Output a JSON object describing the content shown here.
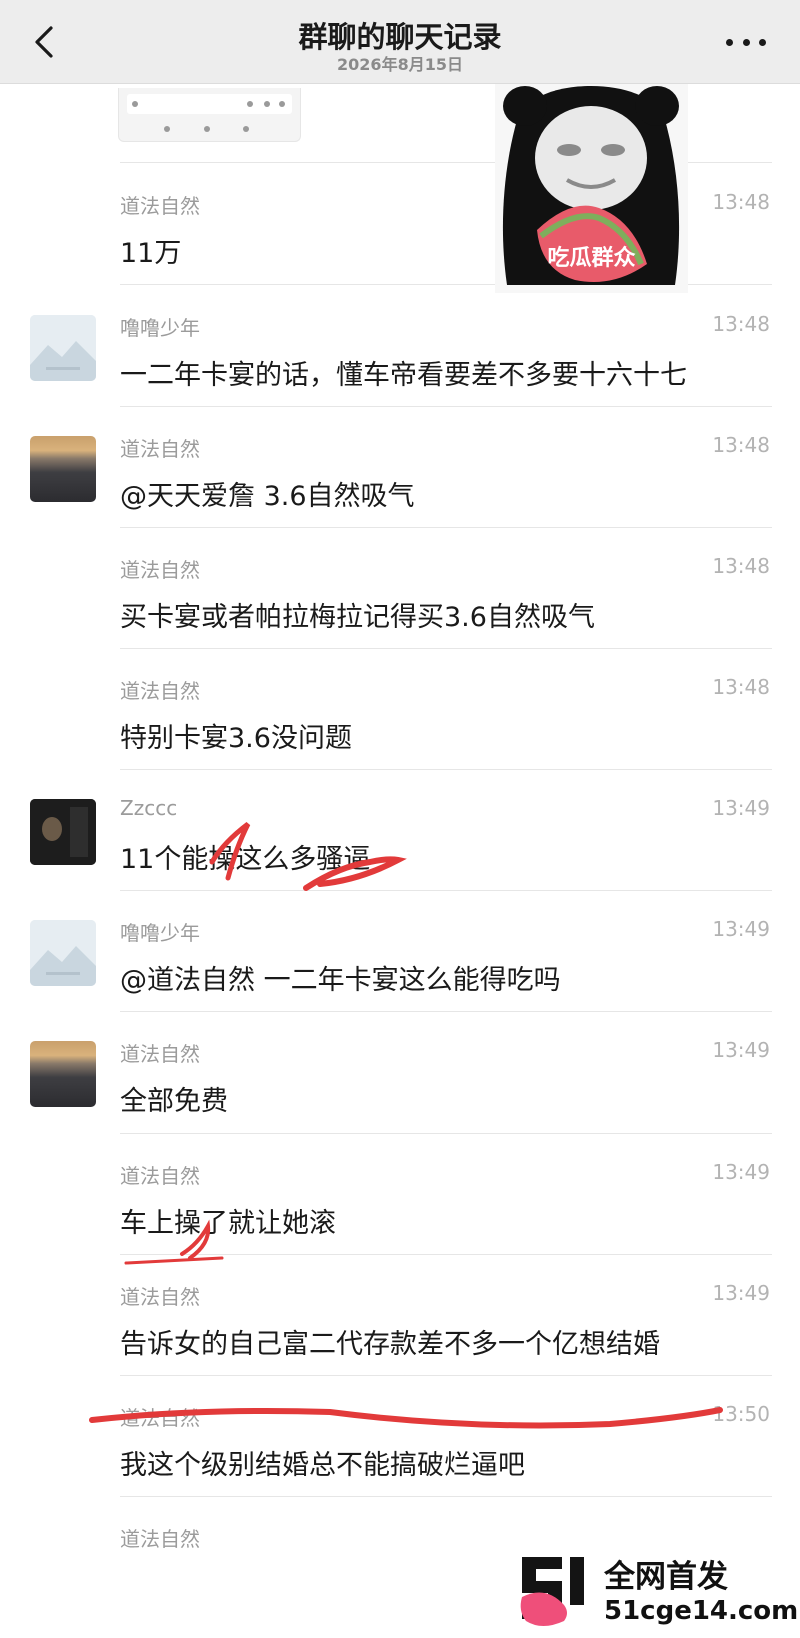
{
  "header": {
    "title": "群聊的聊天记录",
    "date": "2026年8月15日"
  },
  "sticker": {
    "caption": "吃瓜群众"
  },
  "messages": [
    {
      "sender": "道法自然",
      "time": "13:48",
      "text": "11万",
      "avatar": "none"
    },
    {
      "sender": "噜噜少年",
      "time": "13:48",
      "text": "一二年卡宴的话，懂车帝看要差不多要十六十七",
      "avatar": "placeholder"
    },
    {
      "sender": "道法自然",
      "time": "13:48",
      "text": "@天天爱詹 3.6自然吸气",
      "avatar": "sunset"
    },
    {
      "sender": "道法自然",
      "time": "13:48",
      "text": "买卡宴或者帕拉梅拉记得买3.6自然吸气",
      "avatar": "none"
    },
    {
      "sender": "道法自然",
      "time": "13:48",
      "text": "特别卡宴3.6没问题",
      "avatar": "none"
    },
    {
      "sender": "Zzccc",
      "time": "13:49",
      "text": "11个能操这么多骚逼",
      "avatar": "photo"
    },
    {
      "sender": "噜噜少年",
      "time": "13:49",
      "text": "@道法自然 一二年卡宴这么能得吃吗",
      "avatar": "placeholder"
    },
    {
      "sender": "道法自然",
      "time": "13:49",
      "text": "全部免费",
      "avatar": "sunset"
    },
    {
      "sender": "道法自然",
      "time": "13:49",
      "text": "车上操了就让她滚",
      "avatar": "none"
    },
    {
      "sender": "道法自然",
      "time": "13:49",
      "text": "告诉女的自己富二代存款差不多一个亿想结婚",
      "avatar": "none"
    },
    {
      "sender": "道法自然",
      "time": "13:50",
      "text": "我这个级别结婚总不能搞破烂逼吧",
      "avatar": "none"
    },
    {
      "sender": "道法自然",
      "time": "",
      "text": "",
      "avatar": "none"
    }
  ],
  "watermark": {
    "line1": "全网首发",
    "line2": "51cge14.com"
  },
  "colors": {
    "navbar_bg": "#ededed",
    "annotation_red": "#e23a3a"
  }
}
